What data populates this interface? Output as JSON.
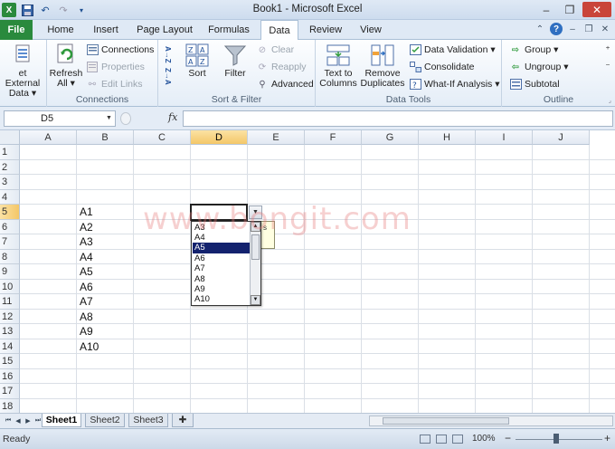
{
  "window": {
    "title": "Book1 - Microsoft Excel",
    "minimize": "–",
    "restore": "❐",
    "close": "✕"
  },
  "tabs": {
    "file": "File",
    "items": [
      "Home",
      "Insert",
      "Page Layout",
      "Formulas",
      "Data",
      "Review",
      "View"
    ],
    "active": "Data"
  },
  "ribbon": {
    "get_external": {
      "line1": "et External",
      "line2": "Data ▾"
    },
    "refresh": {
      "line1": "Refresh",
      "line2": "All ▾"
    },
    "connections": "Connections",
    "properties": "Properties",
    "edit_links": "Edit Links",
    "connections_group": "Connections",
    "sort_az": "A→Z",
    "sort_za": "Z→A",
    "sort": "Sort",
    "filter": "Filter",
    "clear": "Clear",
    "reapply": "Reapply",
    "advanced": "Advanced",
    "sort_filter_group": "Sort & Filter",
    "text_to_columns": {
      "line1": "Text to",
      "line2": "Columns"
    },
    "remove_duplicates": {
      "line1": "Remove",
      "line2": "Duplicates"
    },
    "data_validation": "Data Validation ▾",
    "consolidate": "Consolidate",
    "what_if": "What-If Analysis ▾",
    "data_tools_group": "Data Tools",
    "group": "Group ▾",
    "ungroup": "Ungroup ▾",
    "subtotal": "Subtotal",
    "outline_group": "Outline"
  },
  "formula_bar": {
    "name_box": "D5",
    "fx": "fx",
    "value": ""
  },
  "grid": {
    "columns": [
      "A",
      "B",
      "C",
      "D",
      "E",
      "F",
      "G",
      "H",
      "I",
      "J"
    ],
    "rows": [
      "1",
      "2",
      "3",
      "4",
      "5",
      "6",
      "7",
      "8",
      "9",
      "10",
      "11",
      "12",
      "13",
      "14",
      "15",
      "16",
      "17",
      "18"
    ],
    "selected_column": "D",
    "selected_row": "5",
    "column_b_values": [
      "A1",
      "A2",
      "A3",
      "A4",
      "A5",
      "A6",
      "A7",
      "A8",
      "A9",
      "A10"
    ]
  },
  "dropdown": {
    "items": [
      "A3",
      "A4",
      "A5",
      "A6",
      "A7",
      "A8",
      "A9",
      "A10"
    ],
    "selected": "A5",
    "tooltip": "s"
  },
  "watermark": "www.bongit.com",
  "sheets": {
    "items": [
      "Sheet1",
      "Sheet2",
      "Sheet3"
    ],
    "active": "Sheet1"
  },
  "status": {
    "text": "Ready",
    "zoom": "100%",
    "zoom_minus": "−",
    "zoom_plus": "+"
  }
}
